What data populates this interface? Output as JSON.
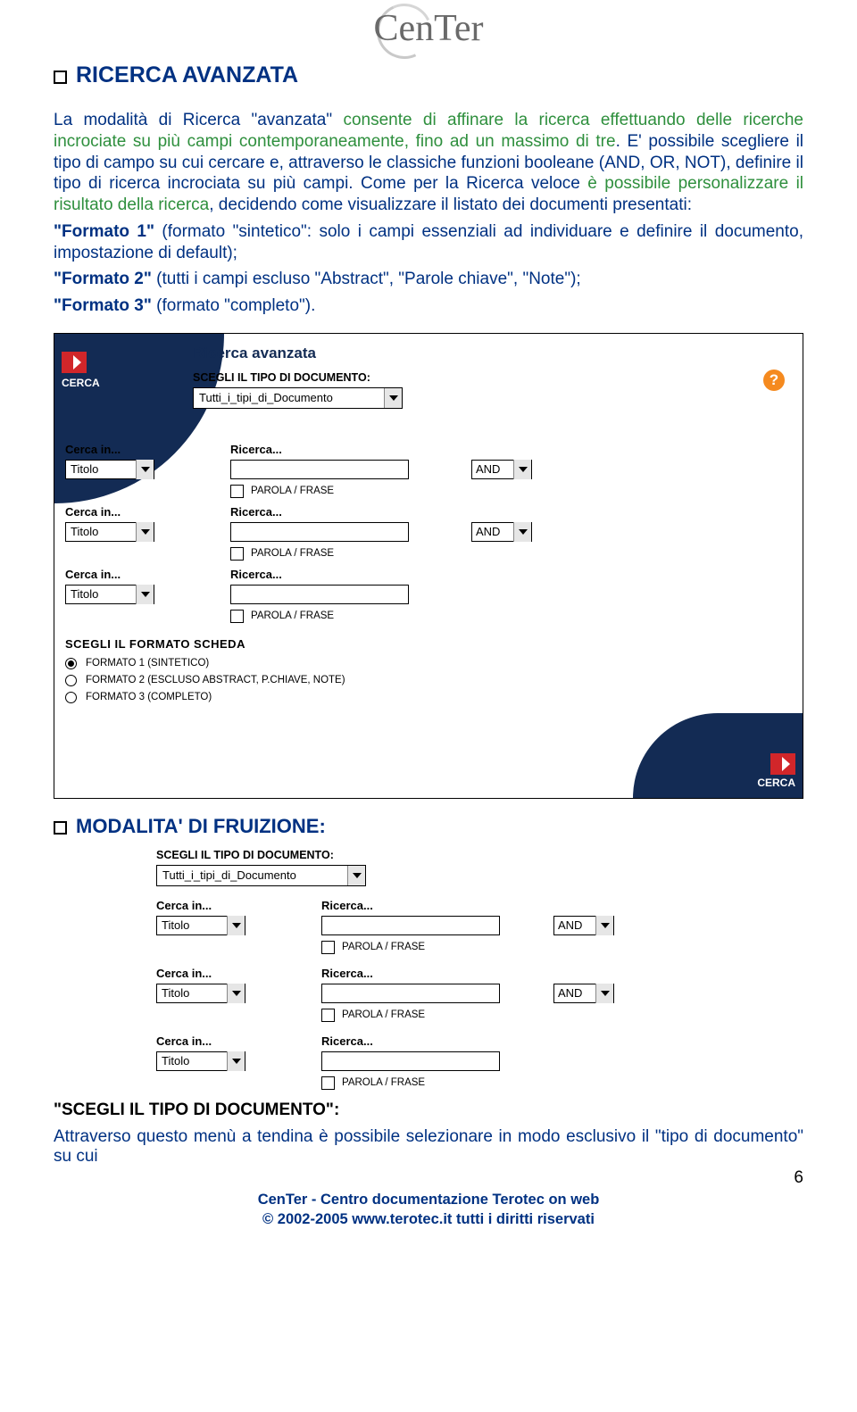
{
  "logo_text": "CenTer",
  "section1": {
    "title": "RICERCA AVANZATA",
    "p1a": "La modalità di Ricerca \"avanzata\" ",
    "p1b": "consente di affinare la ricerca effettuando delle ricerche incrociate su più campi contemporaneamente, fino ad un massimo di tre",
    "p1c": ". E' possibile scegliere il tipo di campo su cui cercare e, attraverso le classiche funzioni booleane (AND, OR, NOT), definire il tipo di ricerca incrociata su più campi. Come per la Ricerca veloce ",
    "p1d": "è possibile personalizzare il risultato della ricerca",
    "p1e": ", decidendo come visualizzare il listato dei documenti presentati:",
    "fmt1a": "\"Formato 1\"",
    "fmt1b": " (formato \"sintetico\": solo i campi essenziali ad individuare e definire il documento, impostazione di default);",
    "fmt2a": "\"Formato 2\"",
    "fmt2b": " (tutti i campi escluso \"Abstract\", \"Parole chiave\", \"Note\");",
    "fmt3a": "\"Formato 3\"",
    "fmt3b": " (formato \"completo\")."
  },
  "form": {
    "title": "Ricerca avanzata",
    "doc_head": "SCEGLI IL TIPO DI DOCUMENTO:",
    "doc_value": "Tutti_i_tipi_di_Documento",
    "cerca_label": "CERCA",
    "help": "?",
    "lbl_cerca": "Cerca in...",
    "lbl_ricerca": "Ricerca...",
    "field_value": "Titolo",
    "and_value": "AND",
    "parola": "PAROLA / FRASE",
    "fmt_head": "SCEGLI IL FORMATO SCHEDA",
    "fmt1": "FORMATO 1 (SINTETICO)",
    "fmt2": "FORMATO 2 (ESCLUSO ABSTRACT, P.CHIAVE, NOTE)",
    "fmt3": "FORMATO 3 (COMPLETO)"
  },
  "section2": {
    "title": "MODALITA' DI FRUIZIONE:"
  },
  "footer_q": {
    "head": "\"SCEGLI IL TIPO DI DOCUMENTO\":",
    "line": "Attraverso questo menù a tendina è possibile selezionare in modo esclusivo il \"tipo di documento\" su cui"
  },
  "page_number": "6",
  "footer": {
    "l1": "CenTer - Centro documentazione Terotec on web",
    "l2": "© 2002-2005 www.terotec.it  tutti i diritti riservati"
  }
}
